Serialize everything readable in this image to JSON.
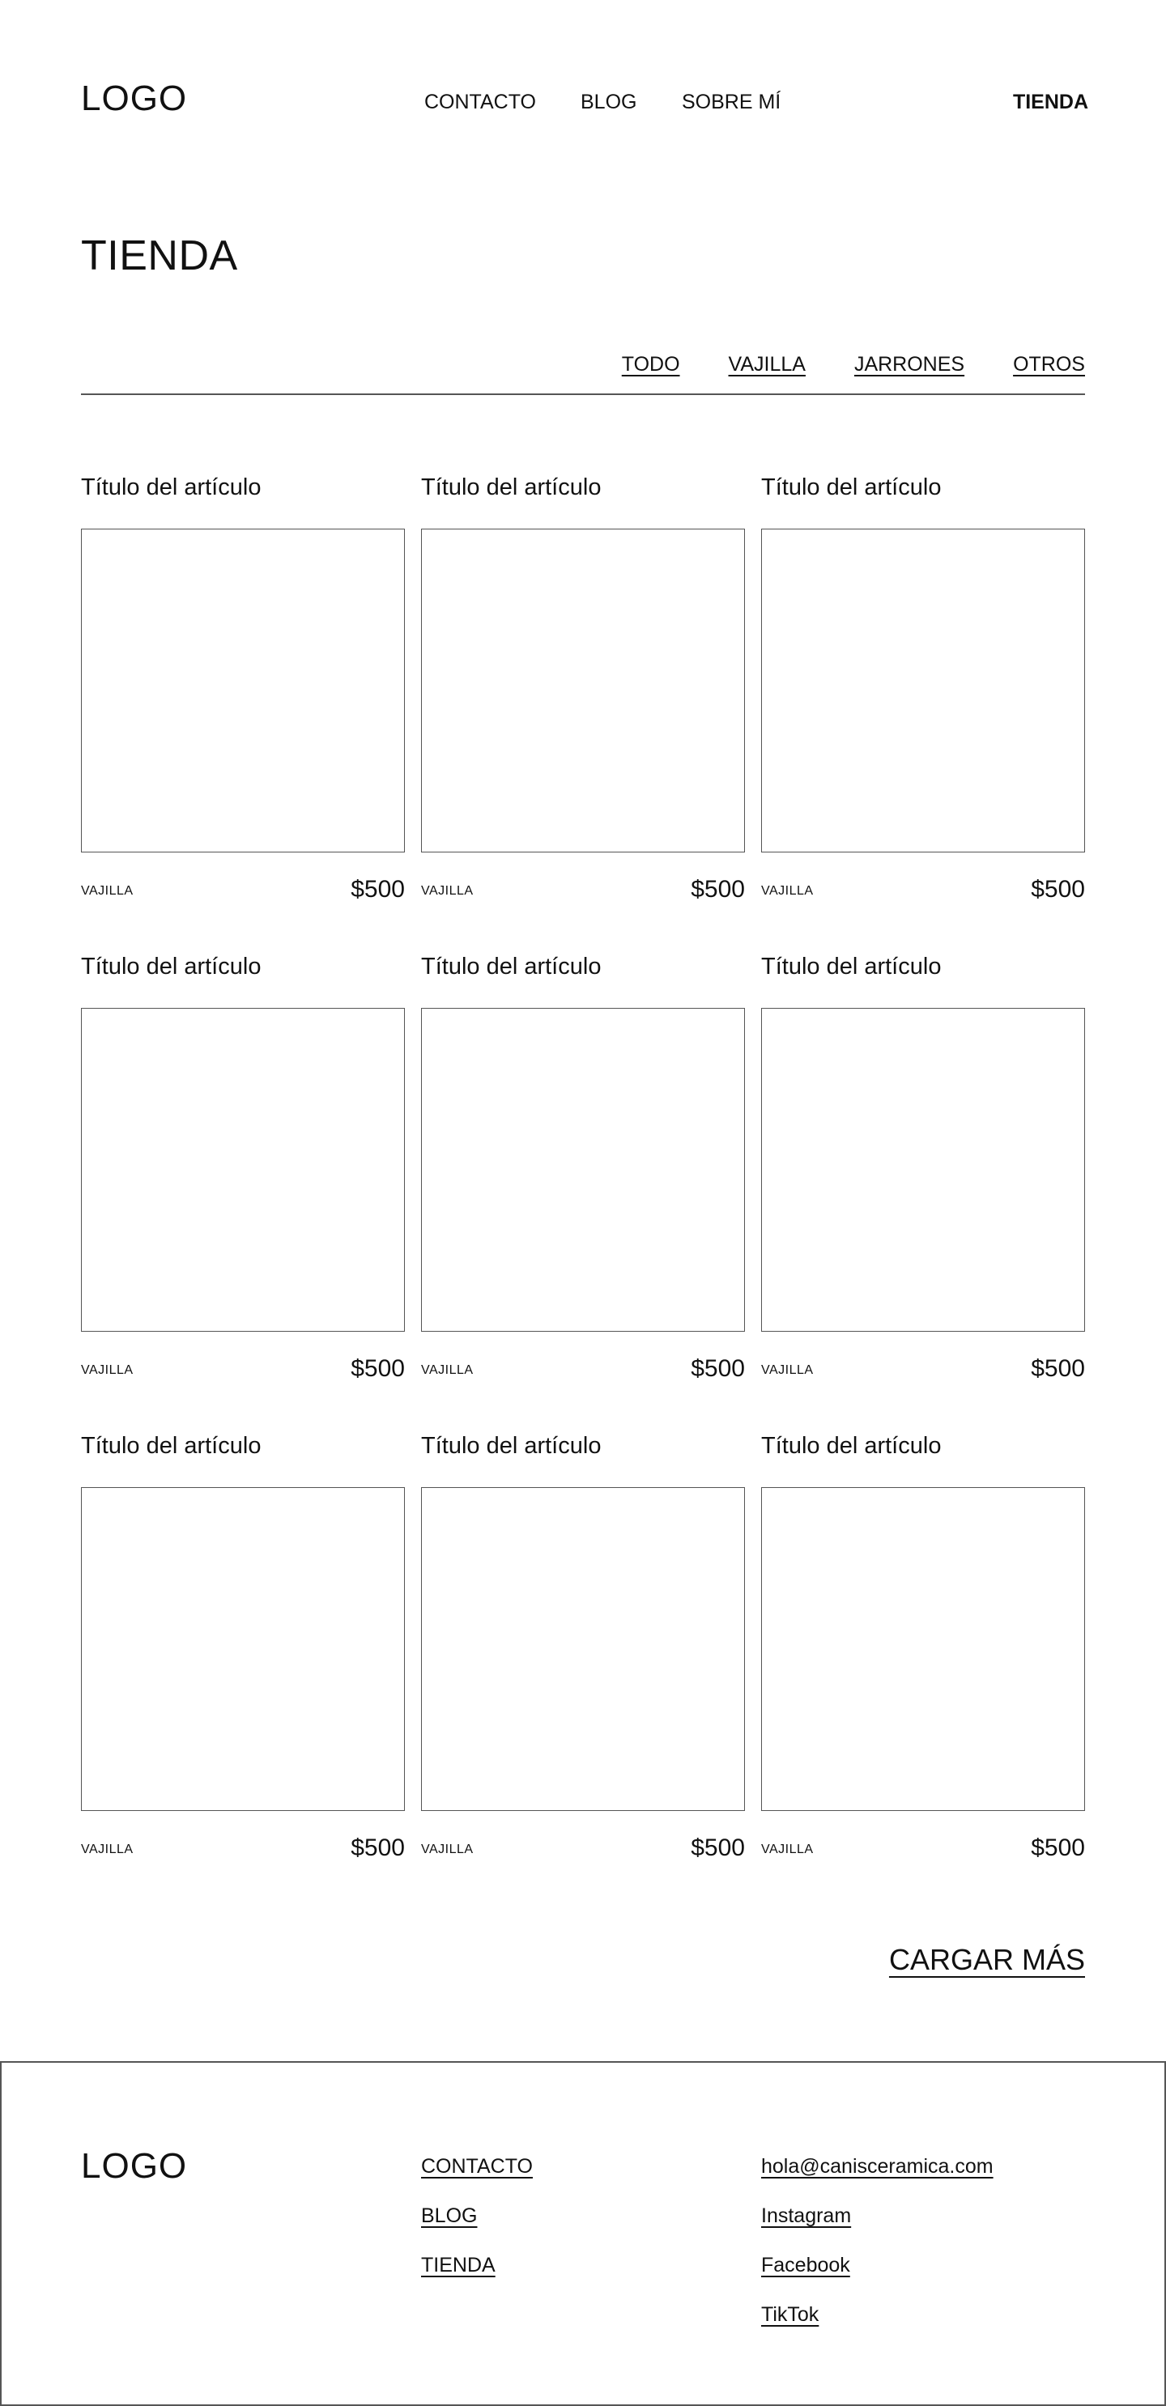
{
  "header": {
    "logo": "LOGO",
    "nav": {
      "contacto": "CONTACTO",
      "blog": "BLOG",
      "sobre_mi": "SOBRE MÍ",
      "tienda": "TIENDA"
    }
  },
  "page": {
    "title": "TIENDA"
  },
  "filters": {
    "todo": "TODO",
    "vajilla": "VAJILLA",
    "jarrones": "JARRONES",
    "otros": "OTROS"
  },
  "products": [
    {
      "title": "Título del artículo",
      "category": "VAJILLA",
      "price": "$500"
    },
    {
      "title": "Título del artículo",
      "category": "VAJILLA",
      "price": "$500"
    },
    {
      "title": "Título del artículo",
      "category": "VAJILLA",
      "price": "$500"
    },
    {
      "title": "Título del artículo",
      "category": "VAJILLA",
      "price": "$500"
    },
    {
      "title": "Título del artículo",
      "category": "VAJILLA",
      "price": "$500"
    },
    {
      "title": "Título del artículo",
      "category": "VAJILLA",
      "price": "$500"
    },
    {
      "title": "Título del artículo",
      "category": "VAJILLA",
      "price": "$500"
    },
    {
      "title": "Título del artículo",
      "category": "VAJILLA",
      "price": "$500"
    },
    {
      "title": "Título del artículo",
      "category": "VAJILLA",
      "price": "$500"
    }
  ],
  "load_more": "CARGAR MÁS",
  "footer": {
    "logo": "LOGO",
    "links": {
      "contacto": "CONTACTO",
      "blog": "BLOG",
      "tienda": "TIENDA"
    },
    "social": {
      "email": "hola@canisceramica.com",
      "instagram": "Instagram",
      "facebook": "Facebook",
      "tiktok": "TikTok"
    }
  }
}
